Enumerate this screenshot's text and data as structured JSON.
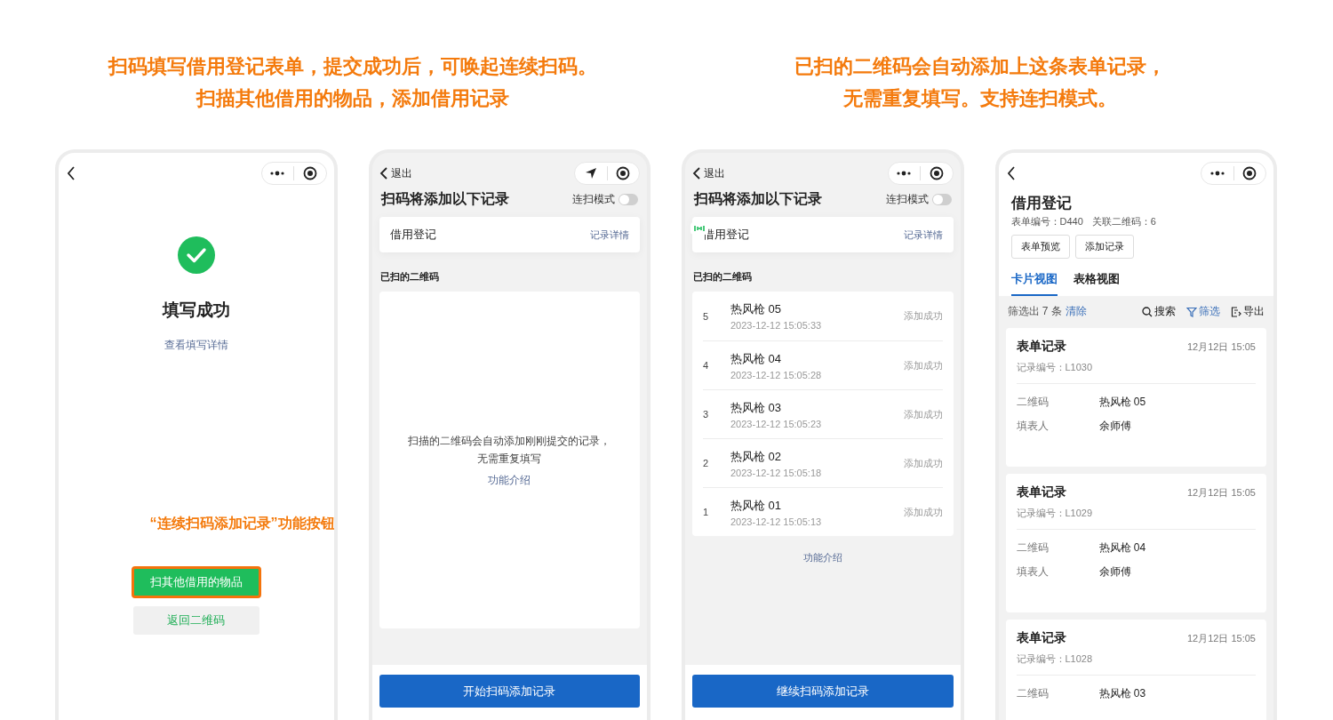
{
  "captions": [
    {
      "lines": [
        "扫码填写借用登记表单，提交成功后，可唤起连续扫码。",
        "扫描其他借用的物品，添加借用记录"
      ]
    },
    {
      "lines": [
        "已扫的二维码会自动添加上这条表单记录，",
        "无需重复填写。支持连扫模式。"
      ]
    }
  ],
  "screens": [
    {
      "kind": "success",
      "nav": {
        "capsule": {
          "kind": "more"
        }
      },
      "title": "填写成功",
      "detail_link": "查看填写详情",
      "annotation": "“连续扫码添加记录”功能按钮",
      "primary_button": {
        "label": "扫其他借用的物品",
        "highlighted": true
      },
      "secondary_button": "返回二维码"
    },
    {
      "kind": "scan",
      "nav": {
        "back_label": "退出",
        "capsule": {
          "kind": "location"
        }
      },
      "title": "扫码将添加以下记录",
      "toggle": {
        "label": "连扫模式",
        "on": false
      },
      "record": {
        "name": "借用登记",
        "link": "记录详情"
      },
      "section": "已扫的二维码",
      "empty_lines": [
        "扫描的二维码会自动添加刚刚提交的记录，",
        "无需重复填写"
      ],
      "intro_link": "功能介绍",
      "bottom_button": "开始扫码添加记录"
    },
    {
      "kind": "scan",
      "nav": {
        "back_label": "退出",
        "capsule": {
          "kind": "more"
        }
      },
      "title": "扫码将添加以下记录",
      "toggle": {
        "label": "连扫模式",
        "on": false
      },
      "record": {
        "name": "借用登记",
        "link": "记录详情"
      },
      "section": "已扫的二维码",
      "items": [
        {
          "index": "5",
          "name": "热风枪 05",
          "time": "2023-12-12 15:05:33",
          "status": "添加成功"
        },
        {
          "index": "4",
          "name": "热风枪 04",
          "time": "2023-12-12 15:05:28",
          "status": "添加成功"
        },
        {
          "index": "3",
          "name": "热风枪 03",
          "time": "2023-12-12 15:05:23",
          "status": "添加成功"
        },
        {
          "index": "2",
          "name": "热风枪 02",
          "time": "2023-12-12 15:05:18",
          "status": "添加成功"
        },
        {
          "index": "1",
          "name": "热风枪 01",
          "time": "2023-12-12 15:05:13",
          "status": "添加成功"
        }
      ],
      "intro_link": "功能介绍",
      "bottom_button": "继续扫码添加记录"
    },
    {
      "kind": "records",
      "nav": {
        "capsule": {
          "kind": "more"
        }
      },
      "title": "借用登记",
      "meta": [
        "表单编号：D440",
        "关联二维码：6"
      ],
      "buttons": [
        "表单预览",
        "添加记录"
      ],
      "tabs": [
        {
          "label": "卡片视图",
          "selected": true
        },
        {
          "label": "表格视图",
          "selected": false
        }
      ],
      "filter_bar": {
        "count": "筛选出 7 条",
        "clear": "清除",
        "actions": [
          {
            "kind": "search",
            "label": "搜索",
            "active": false
          },
          {
            "kind": "filter",
            "label": "筛选",
            "active": true
          },
          {
            "kind": "export",
            "label": "导出",
            "active": false
          }
        ]
      },
      "cards": [
        {
          "title": "表单记录",
          "time": "12月12日 15:05",
          "number": "记录编号：L1030",
          "fields": [
            {
              "label": "二维码",
              "value": "热风枪 05"
            },
            {
              "label": "填表人",
              "value": "余师傅"
            }
          ]
        },
        {
          "title": "表单记录",
          "time": "12月12日 15:05",
          "number": "记录编号：L1029",
          "fields": [
            {
              "label": "二维码",
              "value": "热风枪 04"
            },
            {
              "label": "填表人",
              "value": "余师傅"
            }
          ]
        },
        {
          "title": "表单记录",
          "time": "12月12日 15:05",
          "number": "记录编号：L1028",
          "fields": [
            {
              "label": "二维码",
              "value": "热风枪 03"
            }
          ]
        }
      ]
    }
  ]
}
